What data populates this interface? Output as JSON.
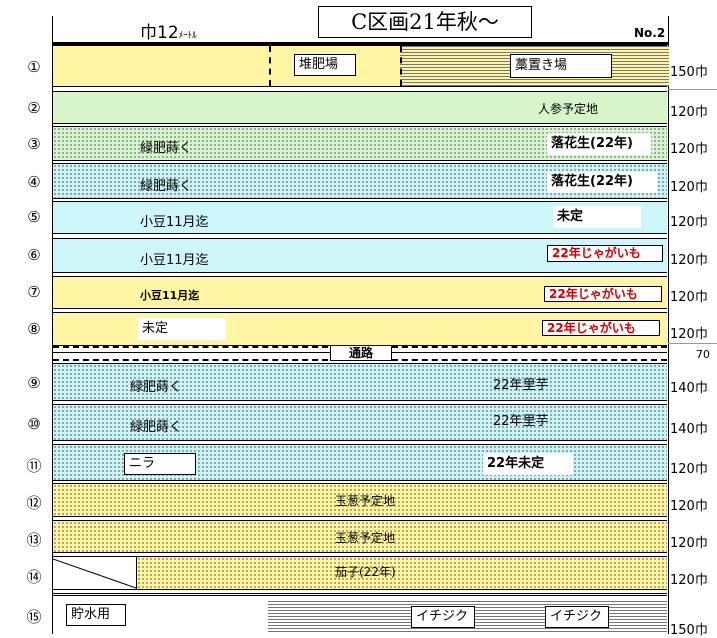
{
  "header": {
    "left_main": "巾12",
    "left_unit": "ﾒｰﾄﾙ",
    "title": "C区画21年秋～",
    "page_no": "No.2"
  },
  "rows": [
    {
      "num": "①",
      "width": "150巾",
      "texts": [
        "堆肥場",
        "藁置き場"
      ]
    },
    {
      "num": "②",
      "width": "120巾",
      "texts": [
        "人参予定地"
      ]
    },
    {
      "num": "③",
      "width": "120巾",
      "texts": [
        "緑肥蒔く",
        "落花生(22年)"
      ]
    },
    {
      "num": "④",
      "width": "120巾",
      "texts": [
        "緑肥蒔く",
        "落花生(22年)"
      ]
    },
    {
      "num": "⑤",
      "width": "120巾",
      "texts": [
        "小豆11月迄",
        "未定"
      ]
    },
    {
      "num": "⑥",
      "width": "120巾",
      "texts": [
        "小豆11月迄",
        "22年じゃがいも"
      ]
    },
    {
      "num": "⑦",
      "width": "120巾",
      "texts": [
        "小豆11月迄",
        "22年じゃがいも"
      ]
    },
    {
      "num": "⑧",
      "width": "120巾",
      "texts": [
        "未定",
        "22年じゃがいも"
      ]
    },
    {
      "num": "⑨",
      "width": "140巾",
      "texts": [
        "緑肥蒔く",
        "22年里芋"
      ]
    },
    {
      "num": "⑩",
      "width": "140巾",
      "texts": [
        "緑肥蒔く",
        "22年里芋"
      ]
    },
    {
      "num": "⑪",
      "width": "120巾",
      "texts": [
        "ニラ",
        "22年未定"
      ]
    },
    {
      "num": "⑫",
      "width": "120巾",
      "texts": [
        "玉葱予定地"
      ]
    },
    {
      "num": "⑬",
      "width": "120巾",
      "texts": [
        "玉葱予定地"
      ]
    },
    {
      "num": "⑭",
      "width": "120巾",
      "texts": [
        "茄子(22年)"
      ]
    },
    {
      "num": "⑮",
      "width": "150巾",
      "texts": [
        "貯水用",
        "イチジク",
        "イチジク"
      ]
    }
  ],
  "path": {
    "label": "通路",
    "width": "70"
  }
}
